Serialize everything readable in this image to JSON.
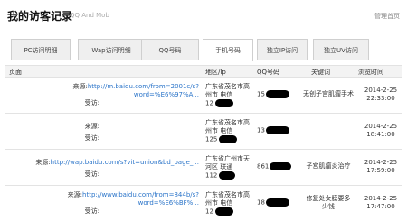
{
  "header": {
    "title": "我的访客记录",
    "subtitle": "QQ And Mob",
    "manage": "管理首页"
  },
  "tabs": [
    {
      "label": "PC访问明细",
      "active": false
    },
    {
      "label": "Wap访问明细",
      "active": false
    },
    {
      "label": "QQ号码",
      "active": false
    },
    {
      "label": "手机号码",
      "active": true
    },
    {
      "label": "独立IP访问",
      "active": false
    },
    {
      "label": "独立UV访问",
      "active": false
    }
  ],
  "table": {
    "headers": [
      "页面",
      "地区/Ip",
      "QQ号码",
      "关键词",
      "浏览时间"
    ],
    "rows": [
      {
        "source_label": "来源:",
        "source_url_line1": "http://m.baidu.com/from=2001c/s?",
        "source_url_line2": "word=%E6%97%A...",
        "visit_label": "受访:",
        "region_line1": "广东省茂名市高",
        "region_line2": "州市 电信",
        "ip": "12",
        "qq": "15",
        "keyword": "无创子宫肌瘤手术",
        "date": "2014-2-25",
        "time": "22:33:00"
      },
      {
        "source_label": "来源:",
        "source_url_line1": "",
        "source_url_line2": "",
        "visit_label": "受访:",
        "region_line1": "广东省茂名市高",
        "region_line2": "州市 电信",
        "ip": "125",
        "qq": "13",
        "keyword": "",
        "date": "2014-2-25",
        "time": "18:41:00"
      },
      {
        "source_label": "来源:",
        "source_url_line1": "http://wap.baidu.com/s?vit=union&bd_page_...",
        "source_url_line2": "",
        "visit_label": "受访:",
        "region_line1": "广东省广州市天",
        "region_line2": "河区 联通",
        "ip": "112",
        "qq": "861",
        "keyword": "子宫肌瘤炎治疗",
        "date": "2014-2-25",
        "time": "17:59:00"
      },
      {
        "source_label": "来源:",
        "source_url_line1": "http://www.baidu.com/from=844b/s?",
        "source_url_line2": "word=%E6%BF%...",
        "visit_label": "受访:",
        "region_line1": "广东省茂名市高",
        "region_line2": "州市 电信",
        "ip": "12",
        "qq": "18",
        "keyword_line1": "修复处女膜要多",
        "keyword_line2": "少钱",
        "date": "2014-2-25",
        "time": "17:47:00"
      }
    ]
  }
}
